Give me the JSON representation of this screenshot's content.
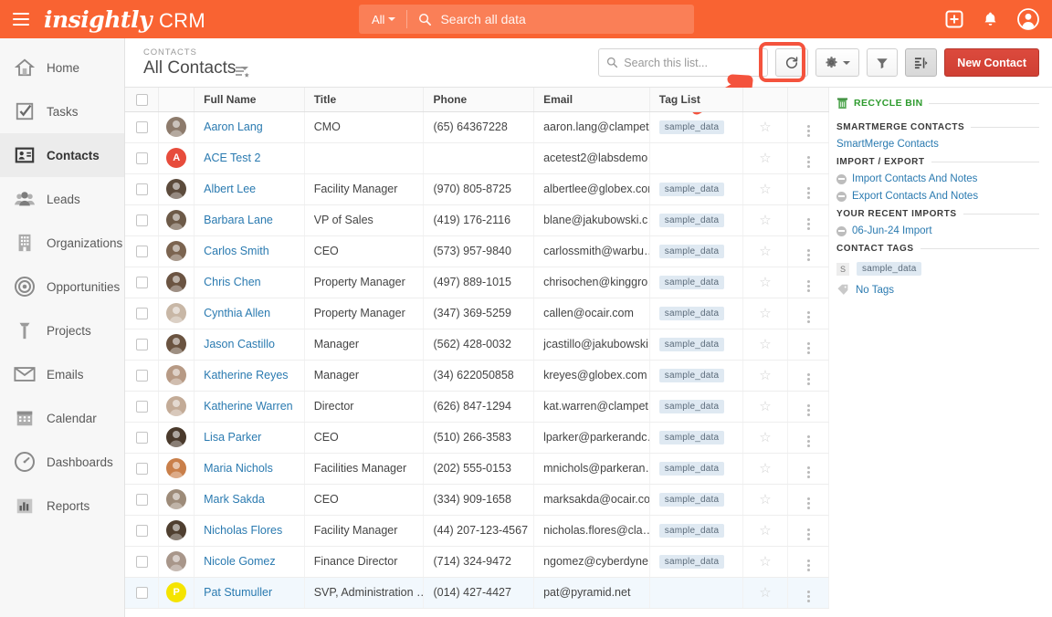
{
  "header": {
    "menu_icon": "hamburger-icon",
    "brand": "insightly",
    "app_name": "CRM",
    "search": {
      "scope": "All",
      "placeholder": "Search all data",
      "value": ""
    },
    "actions": [
      {
        "name": "add-icon",
        "glyph": "+"
      },
      {
        "name": "notifications-bell-icon",
        "glyph": "\u0001"
      },
      {
        "name": "user-avatar-icon",
        "glyph": "\u0001"
      }
    ],
    "colors": {
      "background": "#f96332",
      "text": "#ffffff"
    }
  },
  "sidebar": {
    "items": [
      {
        "label": "Home",
        "icon": "home-icon",
        "active": false
      },
      {
        "label": "Tasks",
        "icon": "checkbox-task-icon",
        "active": false
      },
      {
        "label": "Contacts",
        "icon": "contact-card-icon",
        "active": true
      },
      {
        "label": "Leads",
        "icon": "people-group-icon",
        "active": false
      },
      {
        "label": "Organizations",
        "icon": "building-icon",
        "active": false
      },
      {
        "label": "Opportunities",
        "icon": "target-icon",
        "active": false
      },
      {
        "label": "Projects",
        "icon": "hammer-icon",
        "active": false
      },
      {
        "label": "Emails",
        "icon": "envelope-icon",
        "active": false
      },
      {
        "label": "Calendar",
        "icon": "calendar-icon",
        "active": false
      },
      {
        "label": "Dashboards",
        "icon": "gauge-icon",
        "active": false
      },
      {
        "label": "Reports",
        "icon": "bar-chart-icon",
        "active": false
      }
    ]
  },
  "list_header": {
    "kicker": "CONTACTS",
    "title": "All Contacts",
    "list_view_icon": "list-star-icon",
    "search": {
      "placeholder": "Search this list...",
      "value": ""
    },
    "buttons": [
      {
        "name": "refresh-button",
        "icon": "refresh-icon",
        "highlighted": true
      },
      {
        "name": "settings-button",
        "icon": "gear-icon",
        "has_caret": true
      },
      {
        "name": "filter-button",
        "icon": "funnel-icon"
      },
      {
        "name": "column-layout-button",
        "icon": "columns-icon",
        "active": true
      }
    ],
    "new_button": "New Contact",
    "annotation": {
      "type": "highlight-box-with-arrow",
      "color": "#f4533d",
      "target": "refresh-button"
    }
  },
  "table": {
    "columns": [
      "",
      "",
      "Full Name",
      "Title",
      "Phone",
      "Email",
      "Tag List",
      "",
      ""
    ],
    "rows": [
      {
        "name": "Aaron Lang",
        "title": "CMO",
        "phone": "(65) 64367228",
        "email": "aaron.lang@clampet…",
        "tag": "sample_data",
        "avatar_type": "photo",
        "avatar_color": "#8d7b6c",
        "initial": "",
        "selected": false
      },
      {
        "name": "ACE Test 2",
        "title": "",
        "phone": "",
        "email": "acetest2@labsdemo…",
        "tag": "",
        "avatar_type": "initial",
        "avatar_color": "#e74c3c",
        "initial": "A",
        "selected": false
      },
      {
        "name": "Albert Lee",
        "title": "Facility Manager",
        "phone": "(970) 805-8725",
        "email": "albertlee@globex.com",
        "tag": "sample_data",
        "avatar_type": "photo",
        "avatar_color": "#5c4b3c",
        "initial": "",
        "selected": false
      },
      {
        "name": "Barbara Lane",
        "title": "VP of Sales",
        "phone": "(419) 176-2116",
        "email": "blane@jakubowski.c…",
        "tag": "sample_data",
        "avatar_type": "photo",
        "avatar_color": "#6d5a48",
        "initial": "",
        "selected": false
      },
      {
        "name": "Carlos Smith",
        "title": "CEO",
        "phone": "(573) 957-9840",
        "email": "carlossmith@warbu…",
        "tag": "sample_data",
        "avatar_type": "photo",
        "avatar_color": "#7b6450",
        "initial": "",
        "selected": false
      },
      {
        "name": "Chris Chen",
        "title": "Property Manager",
        "phone": "(497) 889-1015",
        "email": "chrisochen@kinggro…",
        "tag": "sample_data",
        "avatar_type": "photo",
        "avatar_color": "#6b5442",
        "initial": "",
        "selected": false
      },
      {
        "name": "Cynthia Allen",
        "title": "Property Manager",
        "phone": "(347) 369-5259",
        "email": "callen@ocair.com",
        "tag": "sample_data",
        "avatar_type": "photo",
        "avatar_color": "#c8b7a6",
        "initial": "",
        "selected": false
      },
      {
        "name": "Jason Castillo",
        "title": "Manager",
        "phone": "(562) 428-0032",
        "email": "jcastillo@jakubowski…",
        "tag": "sample_data",
        "avatar_type": "photo",
        "avatar_color": "#6a5340",
        "initial": "",
        "selected": false
      },
      {
        "name": "Katherine Reyes",
        "title": "Manager",
        "phone": "(34) 622050858",
        "email": "kreyes@globex.com",
        "tag": "sample_data",
        "avatar_type": "photo",
        "avatar_color": "#b79a85",
        "initial": "",
        "selected": false
      },
      {
        "name": "Katherine Warren",
        "title": "Director",
        "phone": "(626) 847-1294",
        "email": "kat.warren@clampet…",
        "tag": "sample_data",
        "avatar_type": "photo",
        "avatar_color": "#c3ab97",
        "initial": "",
        "selected": false
      },
      {
        "name": "Lisa Parker",
        "title": "CEO",
        "phone": "(510) 266-3583",
        "email": "lparker@parkerandc…",
        "tag": "sample_data",
        "avatar_type": "photo",
        "avatar_color": "#4a3a2c",
        "initial": "",
        "selected": false
      },
      {
        "name": "Maria Nichols",
        "title": "Facilities Manager",
        "phone": "(202) 555-0153",
        "email": "mnichols@parkeran…",
        "tag": "sample_data",
        "avatar_type": "photo",
        "avatar_color": "#c97f4a",
        "initial": "",
        "selected": false
      },
      {
        "name": "Mark Sakda",
        "title": "CEO",
        "phone": "(334) 909-1658",
        "email": "marksakda@ocair.com",
        "tag": "sample_data",
        "avatar_type": "photo",
        "avatar_color": "#9d8b79",
        "initial": "",
        "selected": false
      },
      {
        "name": "Nicholas Flores",
        "title": "Facility Manager",
        "phone": "(44) 207-123-4567",
        "email": "nicholas.flores@cla…",
        "tag": "sample_data",
        "avatar_type": "photo",
        "avatar_color": "#4f3f30",
        "initial": "",
        "selected": false
      },
      {
        "name": "Nicole Gomez",
        "title": "Finance Director",
        "phone": "(714) 324-9472",
        "email": "ngomez@cyberdyne…",
        "tag": "sample_data",
        "avatar_type": "photo",
        "avatar_color": "#a8968a",
        "initial": "",
        "selected": false
      },
      {
        "name": "Pat Stumuller",
        "title": "SVP, Administration …",
        "phone": "(014) 427-4427",
        "email": "pat@pyramid.net",
        "tag": "",
        "avatar_type": "initial",
        "avatar_color": "#f5e400",
        "initial": "P",
        "selected": true
      }
    ]
  },
  "right_panel": {
    "recycle_bin": "RECYCLE BIN",
    "sections": [
      {
        "heading": "SMARTMERGE CONTACTS",
        "links": [
          {
            "label": "SmartMerge Contacts",
            "bullet": false
          }
        ]
      },
      {
        "heading": "IMPORT / EXPORT",
        "links": [
          {
            "label": "Import Contacts And Notes",
            "bullet": true
          },
          {
            "label": "Export Contacts And Notes",
            "bullet": true
          }
        ]
      },
      {
        "heading": "YOUR RECENT IMPORTS",
        "links": [
          {
            "label": "06-Jun-24 Import",
            "bullet": true
          }
        ]
      }
    ],
    "contact_tags_heading": "CONTACT TAGS",
    "tag_letter": "S",
    "tag_name": "sample_data",
    "no_tags": "No Tags"
  }
}
